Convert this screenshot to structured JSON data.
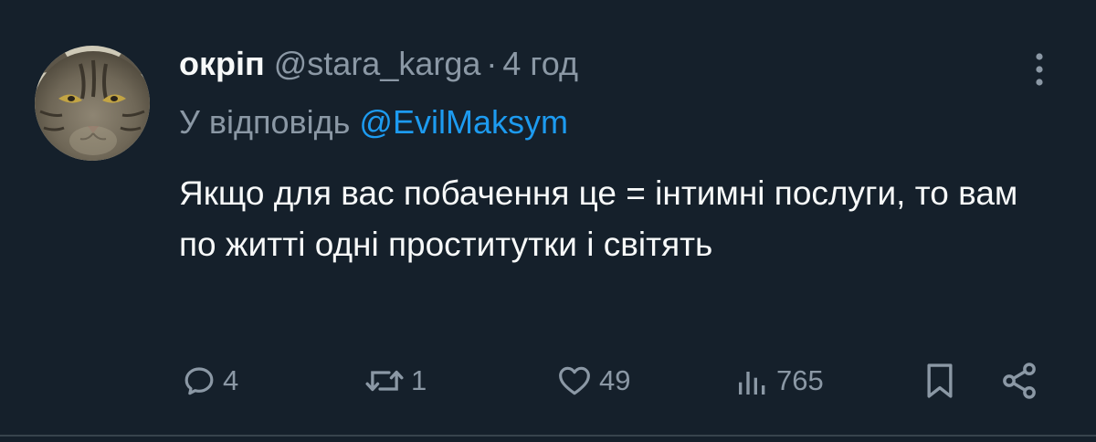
{
  "tweet": {
    "display_name": "окріп",
    "handle": "@stara_karga",
    "separator": "·",
    "time": "4 год",
    "reply_prefix": "У відповідь",
    "reply_to": "@EvilMaksym",
    "text": "Якщо для вас побачення це = інтимні послуги, то вам по житті одні проститутки і світять"
  },
  "actions": {
    "replies": "4",
    "reposts": "1",
    "likes": "49",
    "views": "765"
  },
  "icons": {
    "more": "more-vertical-icon",
    "reply": "reply-icon",
    "repost": "repost-icon",
    "like": "heart-icon",
    "views": "views-icon",
    "bookmark": "bookmark-icon",
    "share": "share-icon"
  },
  "colors": {
    "background": "#15202b",
    "primary_text": "#f7f9f9",
    "secondary_text": "#8b98a5",
    "link": "#1d9bf0",
    "divider": "#38444d"
  }
}
